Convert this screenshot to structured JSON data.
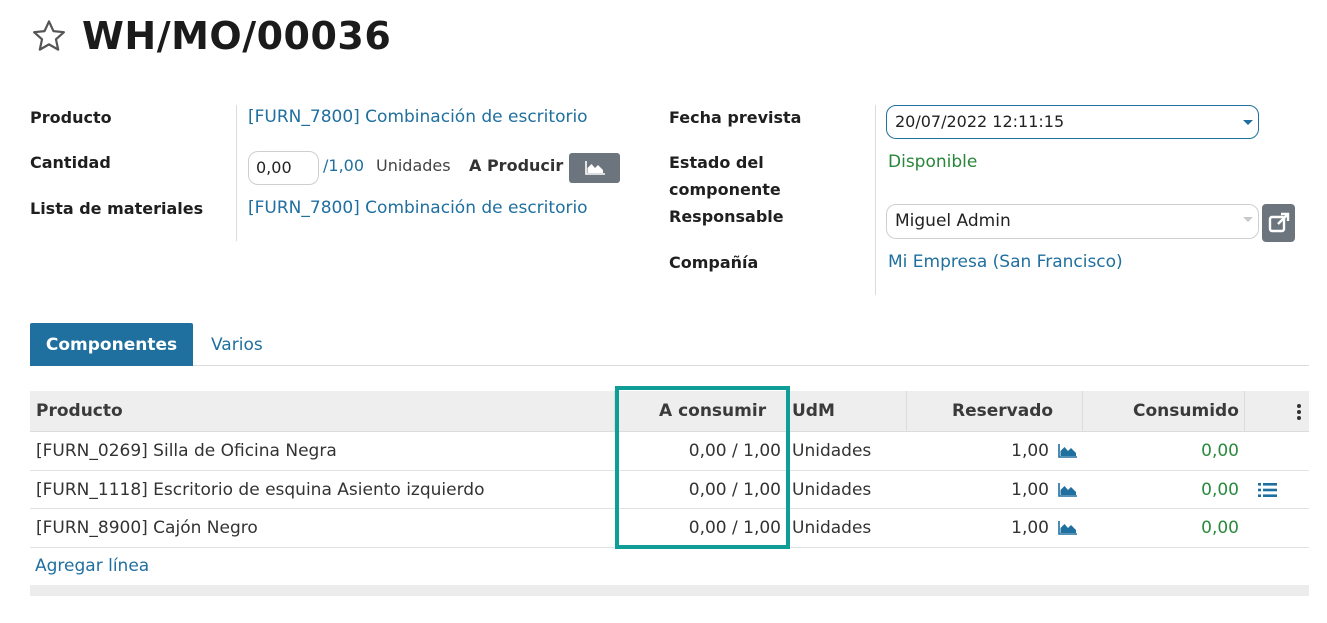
{
  "record": {
    "title": "WH/MO/00036"
  },
  "form": {
    "product_label": "Producto",
    "product_value": "[FURN_7800] Combinación de escritorio",
    "quantity_label": "Cantidad",
    "quantity_value": "0,00",
    "quantity_max": "/1,00",
    "quantity_uom": "Unidades",
    "to_produce_label": "A Producir",
    "bom_label": "Lista de materiales",
    "bom_value": "[FURN_7800] Combinación de escritorio",
    "scheduled_label": "Fecha prevista",
    "scheduled_value": "20/07/2022 12:11:15",
    "component_status_label_1": "Estado del",
    "component_status_label_2": "componente",
    "component_status_value": "Disponible",
    "responsible_label": "Responsable",
    "responsible_value": "Miguel Admin",
    "company_label": "Compañía",
    "company_value": "Mi Empresa (San Francisco)"
  },
  "tabs": [
    {
      "label": "Componentes",
      "active": true
    },
    {
      "label": "Varios",
      "active": false
    }
  ],
  "table": {
    "headers": {
      "product": "Producto",
      "to_consume": "A consumir",
      "uom": "UdM",
      "reserved": "Reservado",
      "consumed": "Consumido"
    },
    "rows": [
      {
        "product": "[FURN_0269] Silla de Oficina Negra",
        "to_consume": "0,00 / 1,00",
        "uom": "Unidades",
        "reserved": "1,00",
        "consumed": "0,00"
      },
      {
        "product": "[FURN_1118] Escritorio de esquina Asiento izquierdo",
        "to_consume": "0,00 / 1,00",
        "uom": "Unidades",
        "reserved": "1,00",
        "consumed": "0,00"
      },
      {
        "product": "[FURN_8900] Cajón Negro",
        "to_consume": "0,00 / 1,00",
        "uom": "Unidades",
        "reserved": "1,00",
        "consumed": "0,00"
      }
    ],
    "add_line": "Agregar línea"
  },
  "colors": {
    "accent": "#1f6f9f",
    "success": "#28863a",
    "highlight": "#0e9e97",
    "button_gray": "#6c757d"
  },
  "icons": [
    "star-icon",
    "area-chart-icon",
    "caret-down-icon",
    "external-link-icon",
    "kebab-menu-icon",
    "list-icon"
  ]
}
